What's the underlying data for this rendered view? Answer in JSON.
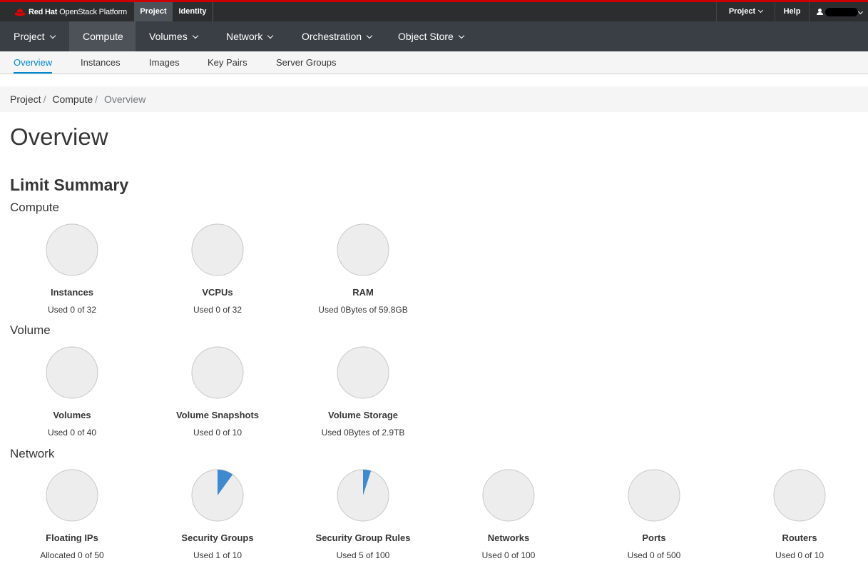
{
  "brand": {
    "name_bold": "Red Hat",
    "name_rest": "OpenStack Platform"
  },
  "top_tabs": {
    "project": "Project",
    "identity": "Identity"
  },
  "top_right": {
    "project": "Project",
    "help": "Help"
  },
  "nav": [
    "Project",
    "Compute",
    "Volumes",
    "Network",
    "Orchestration",
    "Object Store"
  ],
  "subnav": [
    "Overview",
    "Instances",
    "Images",
    "Key Pairs",
    "Server Groups"
  ],
  "breadcrumb": {
    "b1": "Project",
    "b2": "Compute",
    "b3": "Overview",
    "sep": "/"
  },
  "page_title": "Overview",
  "limit_title": "Limit Summary",
  "sections": {
    "compute": "Compute",
    "volume": "Volume",
    "network": "Network"
  },
  "colors": {
    "accent": "#0088ce",
    "pie_fill": "#3f89cf",
    "pie_bg": "#ededed",
    "masthead_border": "#cc0000"
  },
  "chart_data": [
    {
      "type": "pie",
      "label": "Instances",
      "used": 0,
      "limit": 32,
      "usage_text": "Used 0 of 32"
    },
    {
      "type": "pie",
      "label": "VCPUs",
      "used": 0,
      "limit": 32,
      "usage_text": "Used 0 of 32"
    },
    {
      "type": "pie",
      "label": "RAM",
      "used": 0,
      "limit": 59.8,
      "usage_text": "Used 0Bytes of 59.8GB"
    },
    {
      "type": "pie",
      "label": "Volumes",
      "used": 0,
      "limit": 40,
      "usage_text": "Used 0 of 40"
    },
    {
      "type": "pie",
      "label": "Volume Snapshots",
      "used": 0,
      "limit": 10,
      "usage_text": "Used 0 of 10"
    },
    {
      "type": "pie",
      "label": "Volume Storage",
      "used": 0,
      "limit": 2.9,
      "usage_text": "Used 0Bytes of 2.9TB"
    },
    {
      "type": "pie",
      "label": "Floating IPs",
      "used": 0,
      "limit": 50,
      "usage_text": "Allocated 0 of 50"
    },
    {
      "type": "pie",
      "label": "Security Groups",
      "used": 1,
      "limit": 10,
      "usage_text": "Used 1 of 10"
    },
    {
      "type": "pie",
      "label": "Security Group Rules",
      "used": 5,
      "limit": 100,
      "usage_text": "Used 5 of 100"
    },
    {
      "type": "pie",
      "label": "Networks",
      "used": 0,
      "limit": 100,
      "usage_text": "Used 0 of 100"
    },
    {
      "type": "pie",
      "label": "Ports",
      "used": 0,
      "limit": 500,
      "usage_text": "Used 0 of 500"
    },
    {
      "type": "pie",
      "label": "Routers",
      "used": 0,
      "limit": 10,
      "usage_text": "Used 0 of 10"
    }
  ]
}
